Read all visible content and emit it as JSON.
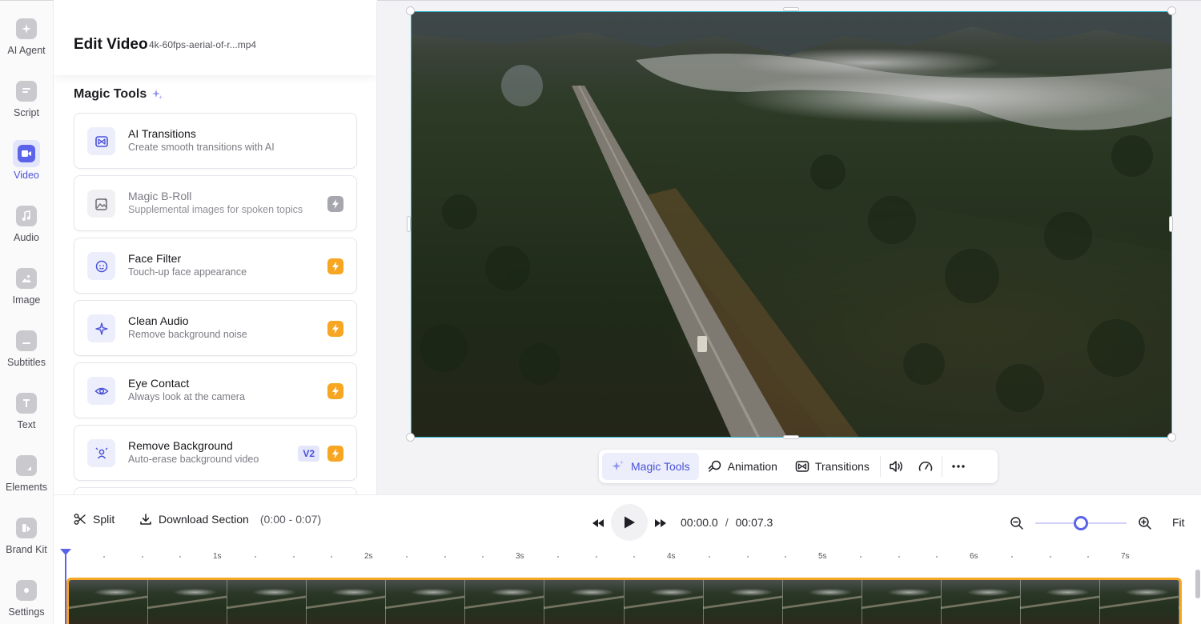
{
  "rail": {
    "items": [
      {
        "label": "AI Agent",
        "icon": "sparkle-icon"
      },
      {
        "label": "Script",
        "icon": "script-icon"
      },
      {
        "label": "Video",
        "icon": "video-camera-icon",
        "active": true
      },
      {
        "label": "Audio",
        "icon": "music-note-icon"
      },
      {
        "label": "Image",
        "icon": "image-icon"
      },
      {
        "label": "Subtitles",
        "icon": "subtitles-icon"
      },
      {
        "label": "Text",
        "icon": "text-icon"
      },
      {
        "label": "Elements",
        "icon": "shapes-icon"
      },
      {
        "label": "Brand Kit",
        "icon": "brand-kit-icon"
      },
      {
        "label": "Settings",
        "icon": "gear-icon"
      }
    ]
  },
  "panel": {
    "title": "Edit Video",
    "file_name": "4k-60fps-aerial-of-r...mp4",
    "section_title": "Magic Tools",
    "tools": [
      {
        "name": "AI Transitions",
        "desc": "Create smooth transitions with AI",
        "icon": "transitions-icon",
        "badge": ""
      },
      {
        "name": "Magic B-Roll",
        "desc": "Supplemental images for spoken topics",
        "icon": "image-sparkle-icon",
        "badge": "bolt-grey"
      },
      {
        "name": "Face Filter",
        "desc": "Touch-up face appearance",
        "icon": "face-icon",
        "badge": "bolt"
      },
      {
        "name": "Clean Audio",
        "desc": "Remove background noise",
        "icon": "sparkle-icon",
        "badge": "bolt"
      },
      {
        "name": "Eye Contact",
        "desc": "Always look at the camera",
        "icon": "eye-icon",
        "badge": "bolt"
      },
      {
        "name": "Remove Background",
        "desc": "Auto-erase background video",
        "icon": "person-icon",
        "badge": "bolt",
        "tag": "V2"
      }
    ]
  },
  "toolbar": {
    "magic_tools": "Magic Tools",
    "animation": "Animation",
    "transitions": "Transitions"
  },
  "controls": {
    "split": "Split",
    "download": "Download Section",
    "download_range": "(0:00 - 0:07)",
    "current_time": "00:00.0",
    "separator": "/",
    "total_time": "00:07.3",
    "fit": "Fit",
    "zoom_level": 0.5
  },
  "timeline": {
    "ticks": [
      "1s",
      "2s",
      "3s",
      "4s",
      "5s",
      "6s",
      "7s"
    ]
  },
  "colors": {
    "accent": "#5b63e8",
    "bolt": "#f6a623",
    "selection": "#2cb3c9"
  }
}
